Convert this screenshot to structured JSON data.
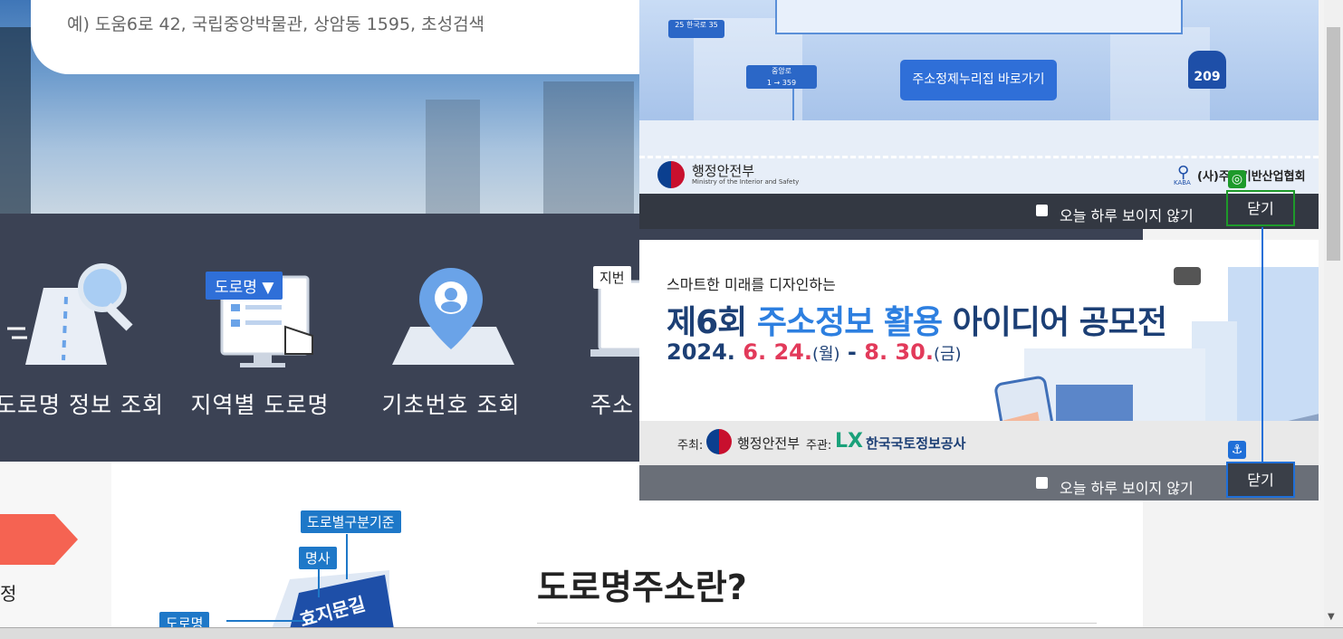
{
  "search": {
    "placeholder": "예) 도움6로 42, 국립중앙박물관, 상암동 1595, 초성검색"
  },
  "menu": {
    "items": [
      {
        "label": "도로명 정보 조회",
        "icon": "magnifier-road-icon"
      },
      {
        "label": "지역별 도로명",
        "icon": "monitor-list-icon",
        "badge": "도로명 ▼"
      },
      {
        "label": "기초번호 조회",
        "icon": "location-pin-icon"
      },
      {
        "label": "주소",
        "icon": "laptop-icon",
        "badge": "지번"
      }
    ]
  },
  "intro": {
    "title": "도로명주소란?",
    "side_text": "정",
    "tags": [
      "도로별구분기준",
      "명사",
      "도로명"
    ],
    "sign_text": "효지문길"
  },
  "popup1": {
    "button_label": "주소정제누리집 바로가기",
    "signs": {
      "s1_top": "25",
      "s1_name": "한국로",
      "s1_num": "35",
      "s2_name": "중앙로",
      "s2_arrow": "1 → 359",
      "s3_num": "209"
    },
    "ministry": "행정안전부",
    "ministry_en": "Ministry of the Interior and Safety",
    "partner": "(사)주소기반산업협회",
    "partner_short": "KABA",
    "dont_show": "오늘 하루 보이지 않기",
    "close": "닫기"
  },
  "popup2": {
    "subtitle": "스마트한 미래를 디자인하는",
    "title_pre": "제6회 ",
    "title_hl": "주소정보 활용",
    "title_post": " 아이디어 공모전",
    "date_y": "2024. ",
    "date_start": "6. 24.",
    "date_start_day": "(월)",
    "date_sep": " - ",
    "date_end": "8. 30.",
    "date_end_day": "(금)",
    "host_label": "주최:",
    "host": "행정안전부",
    "org_label": "주관:",
    "org": "한국국토정보공사",
    "org_logo": "LX",
    "dont_show": "오늘 하루 보이지 않기",
    "close": "닫기"
  }
}
